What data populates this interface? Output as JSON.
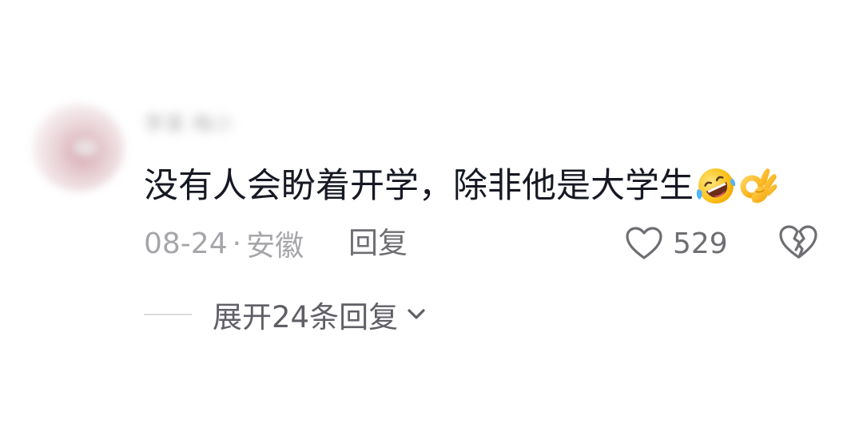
{
  "comment": {
    "username": "李某 梅小",
    "text": "没有人会盼着开学，除非他是大学生",
    "emojis": [
      "rolling-on-floor-laughing-emoji",
      "ok-hand-emoji"
    ],
    "date": "08-24",
    "separator": "·",
    "location": "安徽",
    "reply_label": "回复",
    "like_count": "529",
    "expand_label": "展开24条回复"
  },
  "colors": {
    "text_primary": "#161823",
    "text_secondary": "#a6a6aa",
    "action_text": "#6e6e73",
    "background": "#ffffff"
  },
  "icons": {
    "like": "heart-outline-icon",
    "dislike": "broken-heart-icon",
    "expand": "chevron-down-icon"
  }
}
